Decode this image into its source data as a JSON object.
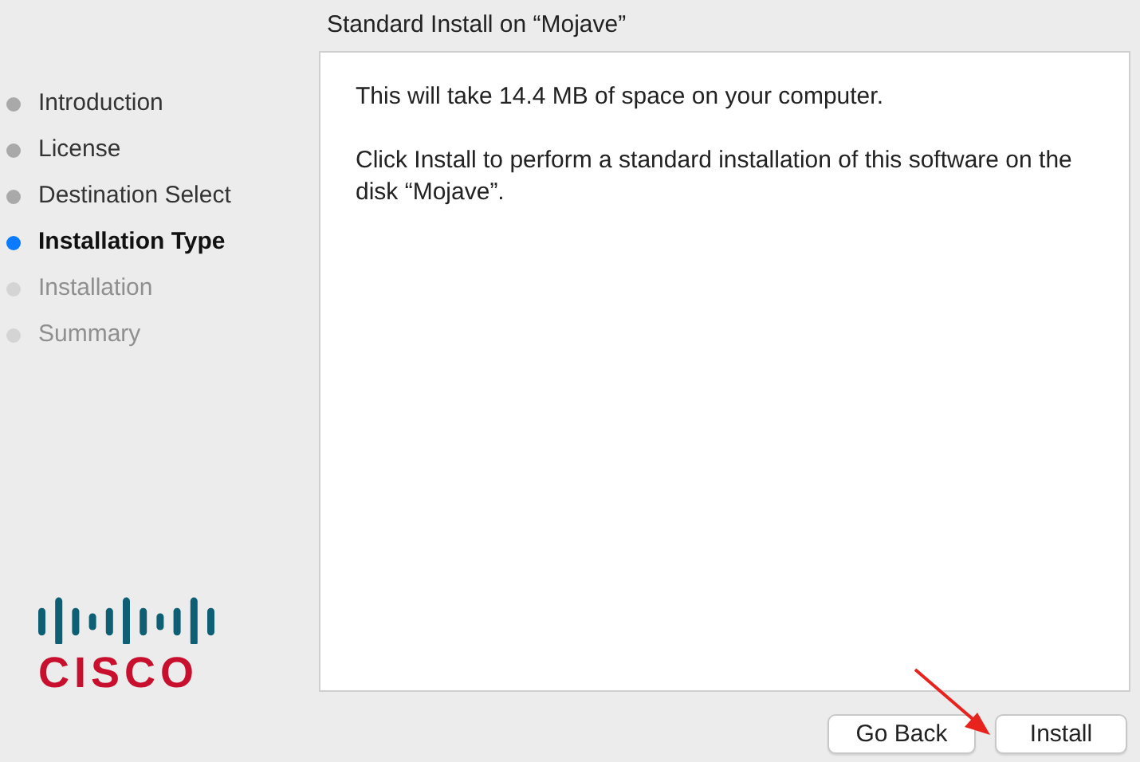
{
  "window": {
    "title": "Standard Install on “Mojave”"
  },
  "steps": [
    {
      "label": "Introduction",
      "selected": false,
      "completed": true
    },
    {
      "label": "License",
      "selected": false,
      "completed": true
    },
    {
      "label": "Destination Select",
      "selected": false,
      "completed": true
    },
    {
      "label": "Installation Type",
      "selected": true,
      "completed": false
    },
    {
      "label": "Installation",
      "selected": false,
      "completed": false
    },
    {
      "label": "Summary",
      "selected": false,
      "completed": false
    }
  ],
  "logo": {
    "text": "CISCO"
  },
  "content": {
    "paragraphs": [
      "This will take 14.4 MB of space on your computer.",
      "Click Install to perform a standard installation of this software on the disk “Mojave”."
    ]
  },
  "buttons": [
    {
      "label": "Go Back"
    },
    {
      "label": "Install"
    }
  ]
}
